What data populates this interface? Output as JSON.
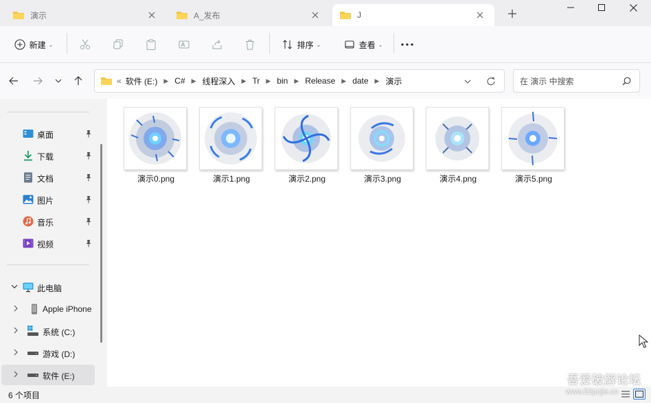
{
  "tabs": [
    {
      "label": "演示",
      "active": false
    },
    {
      "label": "A_发布",
      "active": false
    },
    {
      "label": "J",
      "active": true
    }
  ],
  "toolbar": {
    "new_label": "新建",
    "sort_label": "排序",
    "view_label": "查看"
  },
  "breadcrumb": [
    "软件 (E:)",
    "C#",
    "线程深入",
    "Tr",
    "bin",
    "Release",
    "date",
    "演示"
  ],
  "search": {
    "placeholder": "在 演示 中搜索"
  },
  "sidebar": {
    "quick_access": [
      {
        "label": "桌面",
        "icon": "desktop-icon",
        "color": "#2f8fd9"
      },
      {
        "label": "下载",
        "icon": "download-icon",
        "color": "#1f9b6a"
      },
      {
        "label": "文档",
        "icon": "document-icon",
        "color": "#6b7c8f"
      },
      {
        "label": "图片",
        "icon": "picture-icon",
        "color": "#2a7fd1"
      },
      {
        "label": "音乐",
        "icon": "music-icon",
        "color": "#e06a4a"
      },
      {
        "label": "视频",
        "icon": "video-icon",
        "color": "#7a3fc4"
      }
    ],
    "this_pc": "此电脑",
    "devices": [
      {
        "label": "Apple iPhone",
        "icon": "phone-icon"
      },
      {
        "label": "系统 (C:)",
        "icon": "drive-icon"
      },
      {
        "label": "游戏 (D:)",
        "icon": "drive-icon"
      },
      {
        "label": "软件 (E:)",
        "icon": "drive-icon",
        "selected": true
      }
    ]
  },
  "files": [
    {
      "name": "演示0.png"
    },
    {
      "name": "演示1.png"
    },
    {
      "name": "演示2.png"
    },
    {
      "name": "演示3.png"
    },
    {
      "name": "演示4.png"
    },
    {
      "name": "演示5.png"
    }
  ],
  "status": {
    "item_count": "6 个项目"
  },
  "watermark": {
    "text": "吾爱破解论坛",
    "url": "www.52pojie.cn"
  },
  "colors": {
    "accent": "#0067c0",
    "folder": "#f5c542",
    "effect_core": "#5ab4ff"
  }
}
